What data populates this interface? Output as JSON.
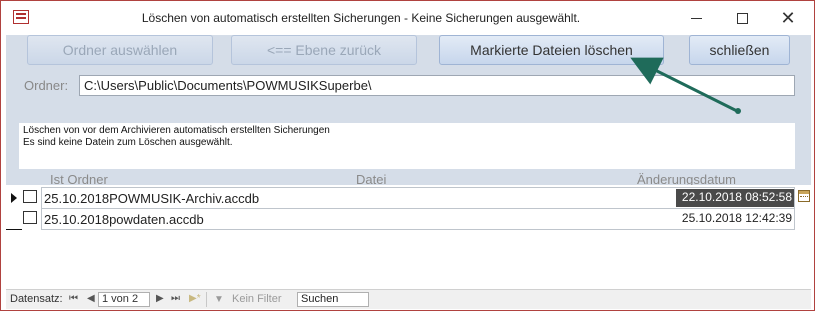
{
  "window": {
    "title": "Löschen von automatisch erstellten Sicherungen - Keine Sicherungen ausgewählt.",
    "minimize_label": "",
    "close_label": "✕"
  },
  "toolbar": {
    "select_folder_label": "Ordner auswählen",
    "level_up_label": "<==  Ebene zurück",
    "delete_marked_label": "Markierte Dateien löschen",
    "close_label": "schließen"
  },
  "folder": {
    "label": "Ordner:",
    "value": "C:\\Users\\Public\\Documents\\POWMUSIKSuperbe\\"
  },
  "info": {
    "line1": "Löschen von vor dem Archivieren automatisch erstellten Sicherungen",
    "line2": "Es sind keine Datein zum Löschen ausgewählt."
  },
  "table": {
    "columns": [
      "Ist Ordner",
      "Datei",
      "Änderungsdatum"
    ],
    "rows": [
      {
        "file": "25.10.2018POWMUSIK-Archiv.accdb",
        "date": "22.10.2018 08:52:58",
        "is_folder": false,
        "selected": true
      },
      {
        "file": "25.10.2018powdaten.accdb",
        "date": "25.10.2018 12:42:39",
        "is_folder": false,
        "selected": false
      }
    ]
  },
  "navbar": {
    "record_label": "Datensatz:",
    "first": "⏮",
    "prev": "◀",
    "position": "1 von 2",
    "next": "▶",
    "last": "⏭",
    "new": "▶*",
    "filter_label": "Kein Filter",
    "search_value": "Suchen"
  },
  "colors": {
    "form_background": "#d5dde8",
    "annotation_arrow": "#1f6b5a",
    "window_border": "#b0423f"
  }
}
